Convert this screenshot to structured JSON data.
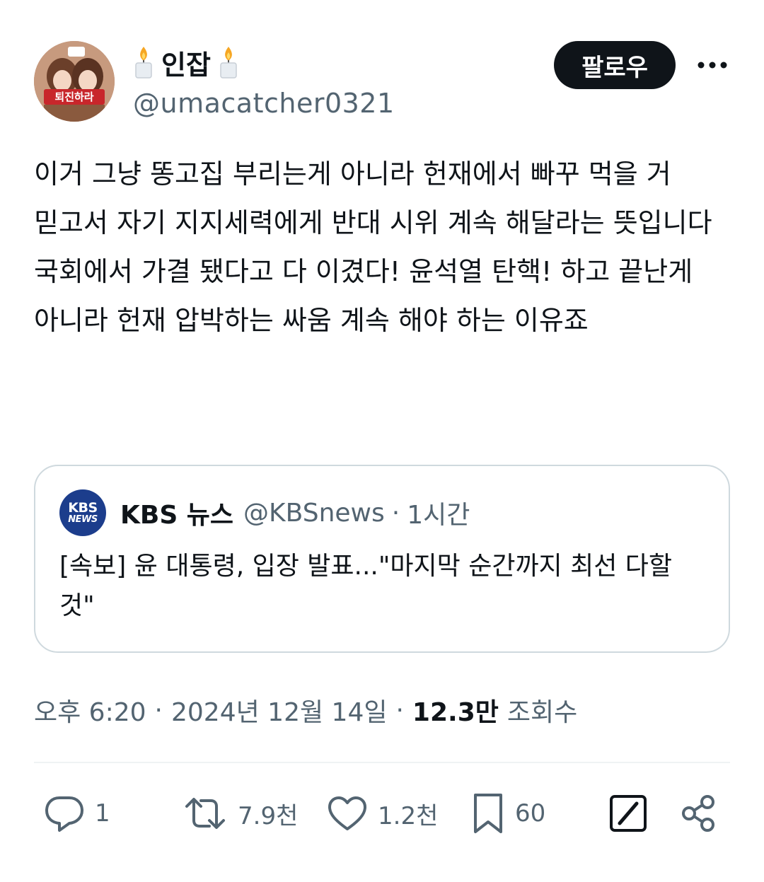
{
  "author": {
    "display_name": "인잡",
    "handle": "@umacatcher0321",
    "avatar_banner_text": "퇴진하라"
  },
  "follow_label": "팔로우",
  "tweet_text": "이거 그냥 똥고집 부리는게 아니라 헌재에서 빠꾸 먹을 거 믿고서 자기 지지세력에게 반대 시위 계속 해달라는 뜻입니다\n국회에서 가결 됐다고 다 이겼다! 윤석열 탄핵! 하고 끝난게 아니라 헌재 압박하는 싸움 계속 해야 하는 이유죠",
  "quote": {
    "logo_top": "KBS",
    "logo_bottom": "NEWS",
    "name": "KBS 뉴스",
    "handle": "@KBSnews",
    "separator": "·",
    "time": "1시간",
    "text": "[속보] 윤 대통령, 입장 발표...\"마지막 순간까지 최선 다할 것\""
  },
  "meta": {
    "time": "오후 6:20",
    "separator": "·",
    "date": "2024년 12월 14일",
    "views_count": "12.3만",
    "views_label": "조회수"
  },
  "actions": {
    "replies": "1",
    "retweets": "7.9천",
    "likes": "1.2천",
    "bookmarks": "60"
  },
  "icons": [
    "candle-icon",
    "more-icon",
    "reply-icon",
    "retweet-icon",
    "like-icon",
    "bookmark-icon",
    "grok-icon",
    "share-icon"
  ],
  "colors": {
    "text": "#0f1419",
    "secondary": "#536471",
    "border": "#cfd9de",
    "follow_bg": "#0f1419",
    "kbs_blue": "#1c3d8c"
  }
}
